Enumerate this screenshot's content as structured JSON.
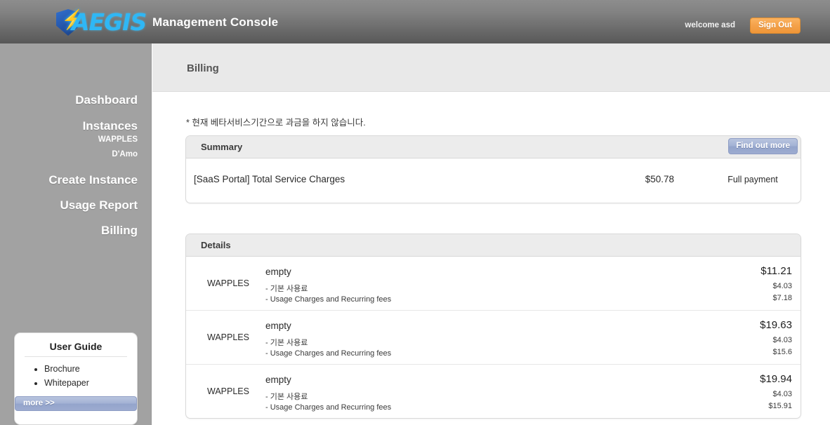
{
  "header": {
    "logo_text": "AEGIS",
    "logo_icon": "shield-lightning-icon",
    "console_title": "Management Console",
    "welcome": "welcome asd",
    "sign_out_label": "Sign Out",
    "accent_color": "#2fb7f5",
    "signout_color": "#f4a14a"
  },
  "sidebar": {
    "items": [
      {
        "label": "Dashboard"
      },
      {
        "label": "Instances"
      },
      {
        "label": "Create Instance"
      },
      {
        "label": "Usage Report"
      },
      {
        "label": "Billing"
      }
    ],
    "sub_items": [
      {
        "label": "WAPPLES"
      },
      {
        "label": "D'Amo"
      }
    ],
    "user_guide": {
      "title": "User Guide",
      "links": [
        {
          "label": "Brochure"
        },
        {
          "label": "Whitepaper"
        }
      ],
      "more_label": "more >>"
    }
  },
  "main": {
    "page_title": "Billing",
    "notice": "* 현재 베타서비스기간으로 과금을 하지 않습니다.",
    "summary": {
      "panel_title": "Summary",
      "find_out_more_label": "Find out more",
      "label": "[SaaS Portal] Total Service Charges",
      "amount": "$50.78",
      "status": "Full payment"
    },
    "details": {
      "panel_title": "Details",
      "rows": [
        {
          "product": "WAPPLES",
          "name": "empty",
          "sub1_label": "- 기본 사용료",
          "sub2_label": "- Usage Charges and Recurring fees",
          "total": "$11.21",
          "sub1_amount": "$4.03",
          "sub2_amount": "$7.18"
        },
        {
          "product": "WAPPLES",
          "name": "empty",
          "sub1_label": "- 기본 사용료",
          "sub2_label": "- Usage Charges and Recurring fees",
          "total": "$19.63",
          "sub1_amount": "$4.03",
          "sub2_amount": "$15.6"
        },
        {
          "product": "WAPPLES",
          "name": "empty",
          "sub1_label": "- 기본 사용료",
          "sub2_label": "- Usage Charges and Recurring fees",
          "total": "$19.94",
          "sub1_amount": "$4.03",
          "sub2_amount": "$15.91"
        }
      ]
    }
  }
}
